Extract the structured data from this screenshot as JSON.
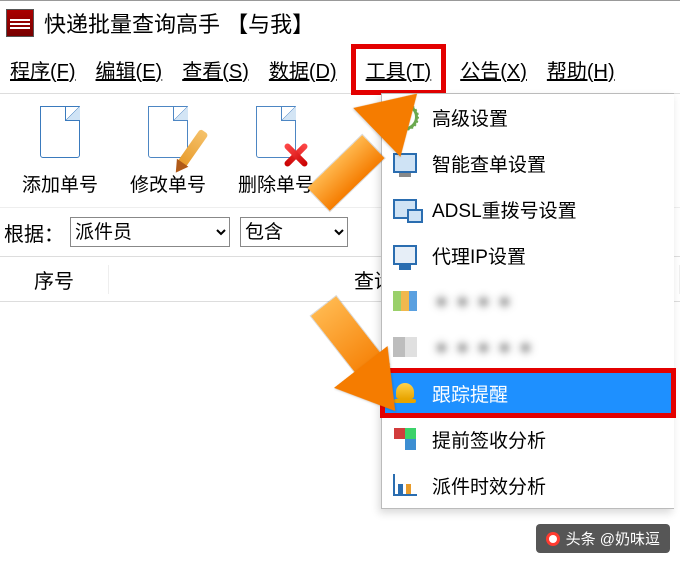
{
  "window": {
    "title": "快递批量查询高手 【与我】"
  },
  "menubar": {
    "items": [
      {
        "label": "程序(F)"
      },
      {
        "label": "编辑(E)"
      },
      {
        "label": "查看(S)"
      },
      {
        "label": "数据(D)"
      },
      {
        "label": "工具(T)",
        "highlight": true
      },
      {
        "label": "公告(X)"
      },
      {
        "label": "帮助(H)"
      }
    ]
  },
  "toolbar": {
    "add": {
      "label": "添加单号"
    },
    "edit": {
      "label": "修改单号"
    },
    "delete": {
      "label": "删除单号"
    }
  },
  "filter": {
    "label": "根据：",
    "field_value": "派件员",
    "op_value": "包含"
  },
  "table": {
    "col_index": "序号",
    "col_time": "查询时间"
  },
  "tools_menu": {
    "items": [
      {
        "label": "高级设置",
        "icon": "gear"
      },
      {
        "label": "智能查单设置",
        "icon": "screen"
      },
      {
        "label": "ADSL重拨号设置",
        "icon": "net"
      },
      {
        "label": "代理IP设置",
        "icon": "proxy"
      },
      {
        "label": "＊＊＊＊",
        "icon": "pix",
        "blur": true
      },
      {
        "label": "＊＊＊＊＊",
        "icon": "pix2",
        "blur": true
      },
      {
        "label": "跟踪提醒",
        "icon": "bell",
        "selected": true
      },
      {
        "label": "提前签收分析",
        "icon": "cubes"
      },
      {
        "label": "派件时效分析",
        "icon": "bar"
      }
    ]
  },
  "watermark": {
    "text": "头条 @奶味逗"
  }
}
